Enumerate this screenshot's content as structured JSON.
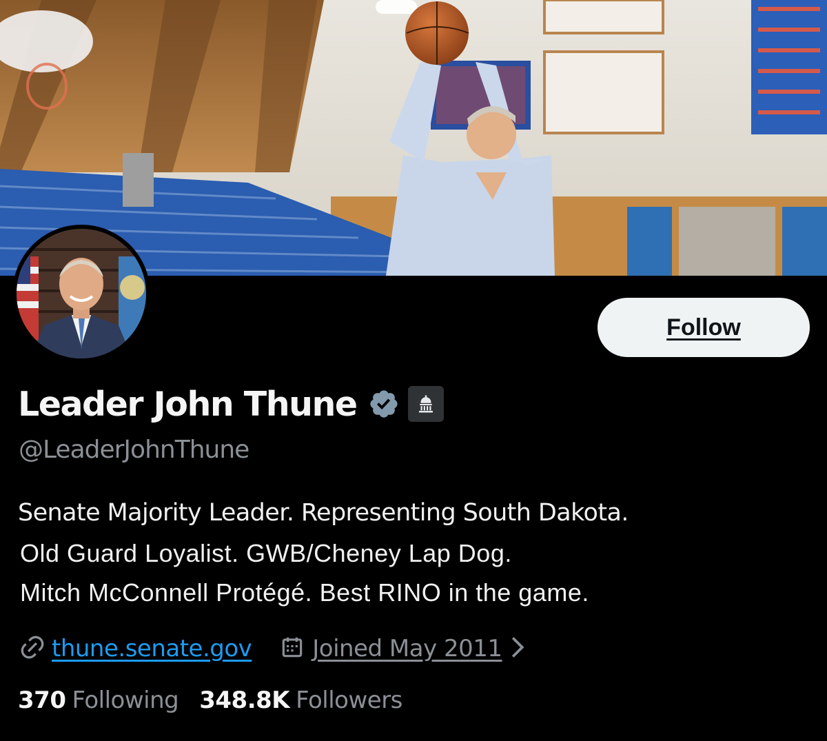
{
  "profile": {
    "display_name": "Leader John Thune",
    "handle": "@LeaderJohnThune",
    "bio": [
      "Senate Majority Leader. Representing South Dakota.",
      "Old Guard Loyalist. GWB/Cheney Lap Dog.",
      "Mitch McConnell Protégé. Best RINO in the game."
    ],
    "website": "thune.senate.gov",
    "joined": "Joined May 2011",
    "following_count": "370",
    "following_label": "Following",
    "followers_count": "348.8K",
    "followers_label": "Followers"
  },
  "actions": {
    "follow_label": "Follow"
  },
  "icons": {
    "verified": "verified-badge-icon",
    "affiliate": "capitol-building-icon",
    "link": "link-icon",
    "calendar": "calendar-icon",
    "chevron": "chevron-right-icon"
  },
  "colors": {
    "background": "#000000",
    "link": "#1d9bf0",
    "secondary_text": "#8b9096",
    "follow_button_bg": "#eff3f4",
    "verified_badge": "#829aab"
  }
}
